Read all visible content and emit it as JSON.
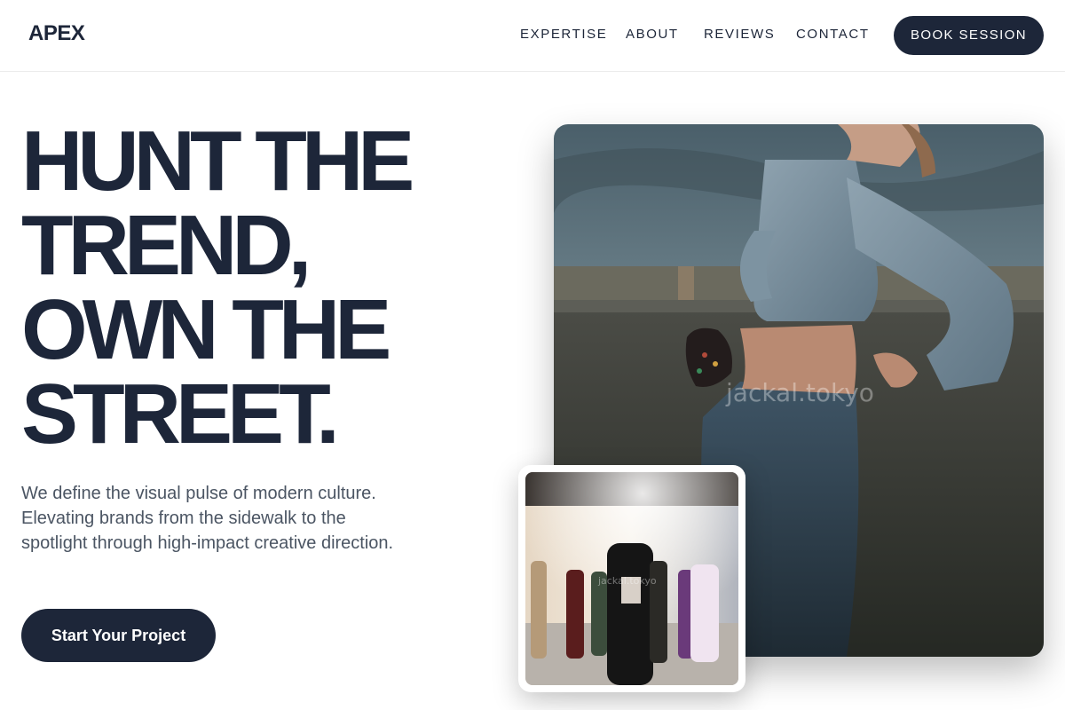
{
  "header": {
    "logo": "APEX",
    "nav": [
      "EXPERTISE",
      "ABOUT",
      "REVIEWS",
      "CONTACT"
    ],
    "book_label": "BOOK SESSION"
  },
  "hero": {
    "headline_lines": [
      "HUNT THE",
      "TREND,",
      "OWN THE",
      "STREET."
    ],
    "tagline": "We define the visual pulse of modern culture. Elevating brands from the sidewalk to the spotlight through high-impact creative direction.",
    "cta_label": "Start Your Project"
  },
  "images": {
    "main": {
      "description": "woman-denim-jacket-rooftop",
      "watermark": "jackal.tokyo"
    },
    "secondary": {
      "description": "fashion-showroom-group",
      "watermark": "jackal.tokyo"
    }
  },
  "colors": {
    "primary": "#1d2639",
    "text_muted": "#4b5563",
    "background": "#ffffff"
  }
}
